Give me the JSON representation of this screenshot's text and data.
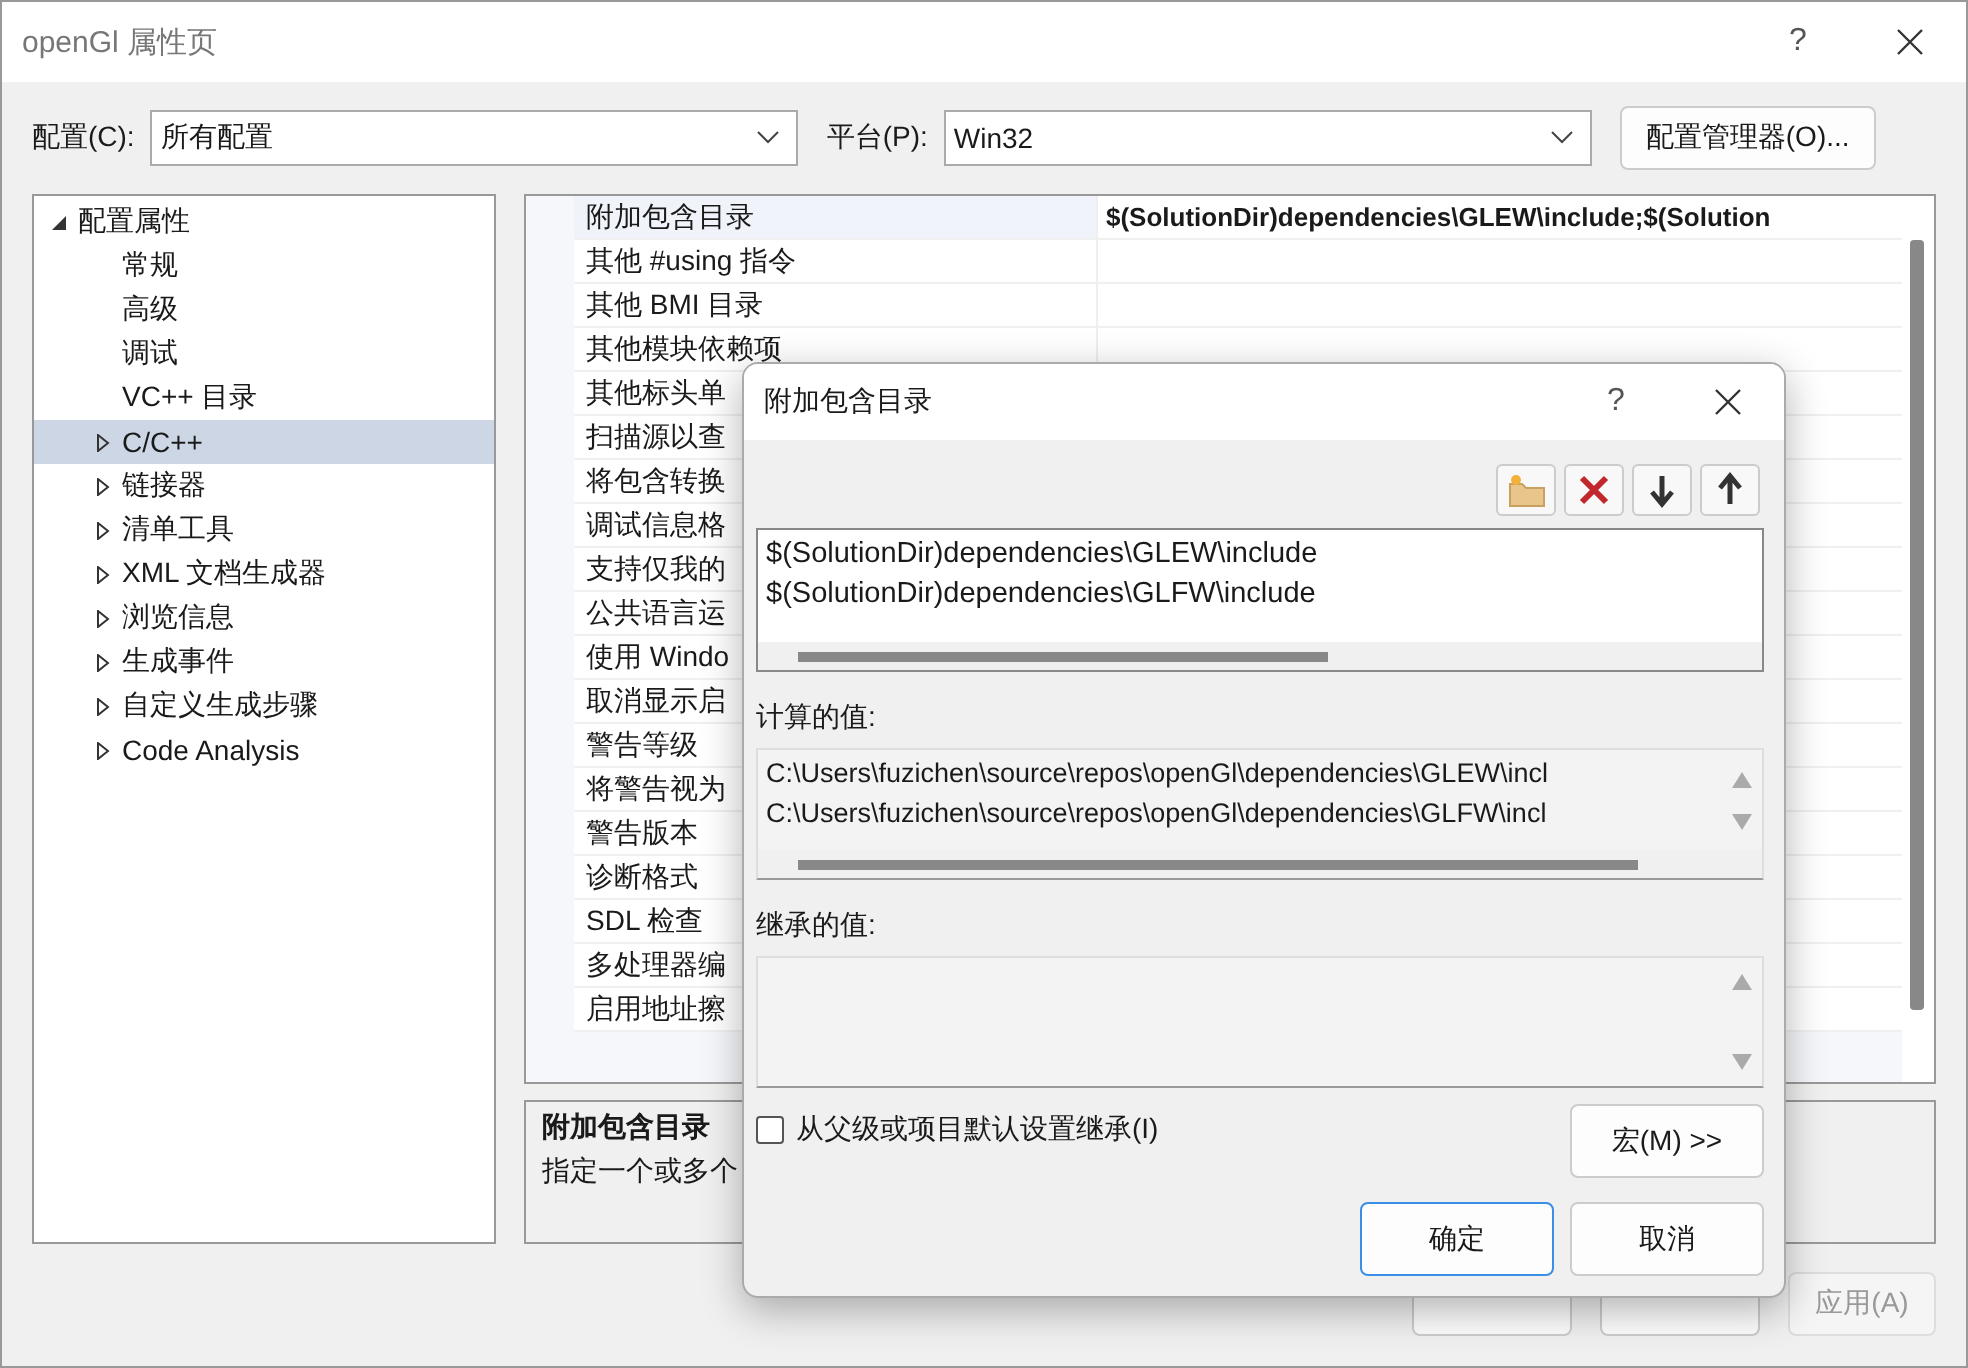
{
  "window": {
    "title": "openGl 属性页",
    "help": "?"
  },
  "config": {
    "label": "配置(C):",
    "value": "所有配置"
  },
  "platform": {
    "label": "平台(P):",
    "value": "Win32"
  },
  "config_manager_button": "配置管理器(O)...",
  "tree": [
    {
      "label": "配置属性",
      "expanded": true,
      "selected": false,
      "children": [
        {
          "label": "常规",
          "kind": "page",
          "selected": false
        },
        {
          "label": "高级",
          "kind": "page",
          "selected": false
        },
        {
          "label": "调试",
          "kind": "page",
          "selected": false
        },
        {
          "label": "VC++ 目录",
          "kind": "page",
          "selected": false
        },
        {
          "label": "C/C++",
          "kind": "group",
          "expanded": false,
          "selected": true
        },
        {
          "label": "链接器",
          "kind": "group",
          "expanded": false,
          "selected": false
        },
        {
          "label": "清单工具",
          "kind": "group",
          "expanded": false,
          "selected": false
        },
        {
          "label": "XML 文档生成器",
          "kind": "group",
          "expanded": false,
          "selected": false
        },
        {
          "label": "浏览信息",
          "kind": "group",
          "expanded": false,
          "selected": false
        },
        {
          "label": "生成事件",
          "kind": "group",
          "expanded": false,
          "selected": false
        },
        {
          "label": "自定义生成步骤",
          "kind": "group",
          "expanded": false,
          "selected": false
        },
        {
          "label": "Code Analysis",
          "kind": "group",
          "expanded": false,
          "selected": false
        }
      ]
    }
  ],
  "properties": [
    {
      "name": "附加包含目录",
      "value": "$(SolutionDir)dependencies\\GLEW\\include;$(Solution",
      "selected": true
    },
    {
      "name": "其他 #using 指令",
      "selected": false
    },
    {
      "name": "其他 BMI 目录",
      "selected": false
    },
    {
      "name": "其他模块依赖项",
      "selected": false
    },
    {
      "name": "其他标头单",
      "selected": false
    },
    {
      "name": "扫描源以查",
      "selected": false
    },
    {
      "name": "将包含转换",
      "selected": false
    },
    {
      "name": "调试信息格",
      "selected": false
    },
    {
      "name": "支持仅我的",
      "selected": false
    },
    {
      "name": "公共语言运",
      "selected": false
    },
    {
      "name": "使用 Windo",
      "selected": false
    },
    {
      "name": "取消显示启",
      "selected": false
    },
    {
      "name": "警告等级",
      "selected": false
    },
    {
      "name": "将警告视为",
      "selected": false
    },
    {
      "name": "警告版本",
      "selected": false
    },
    {
      "name": "诊断格式",
      "selected": false
    },
    {
      "name": "SDL 检查",
      "selected": false
    },
    {
      "name": "多处理器编",
      "selected": false
    },
    {
      "name": "启用地址擦",
      "selected": false
    }
  ],
  "description": {
    "title": "附加包含目录",
    "text": "指定一个或多个"
  },
  "buttons": [
    {
      "disabled": false
    },
    {
      "disabled": false
    },
    {
      "label": "应用(A)",
      "disabled": true
    }
  ],
  "dialog": {
    "title": "附加包含目录",
    "help": "?",
    "entries": [
      "$(SolutionDir)dependencies\\GLEW\\include",
      "$(SolutionDir)dependencies\\GLFW\\include"
    ],
    "computed_label": "计算的值:",
    "computed_values": [
      "C:\\Users\\fuzichen\\source\\repos\\openGl\\dependencies\\GLEW\\incl",
      "C:\\Users\\fuzichen\\source\\repos\\openGl\\dependencies\\GLFW\\incl"
    ],
    "inherited_label": "继承的值:",
    "inherit_checkbox": {
      "label": "从父级或项目默认设置继承(I)",
      "checked": false
    },
    "macros_button": "宏(M) >>",
    "buttons": [
      {
        "label": "确定",
        "default": true
      },
      {
        "label": "取消",
        "default": false
      }
    ]
  }
}
